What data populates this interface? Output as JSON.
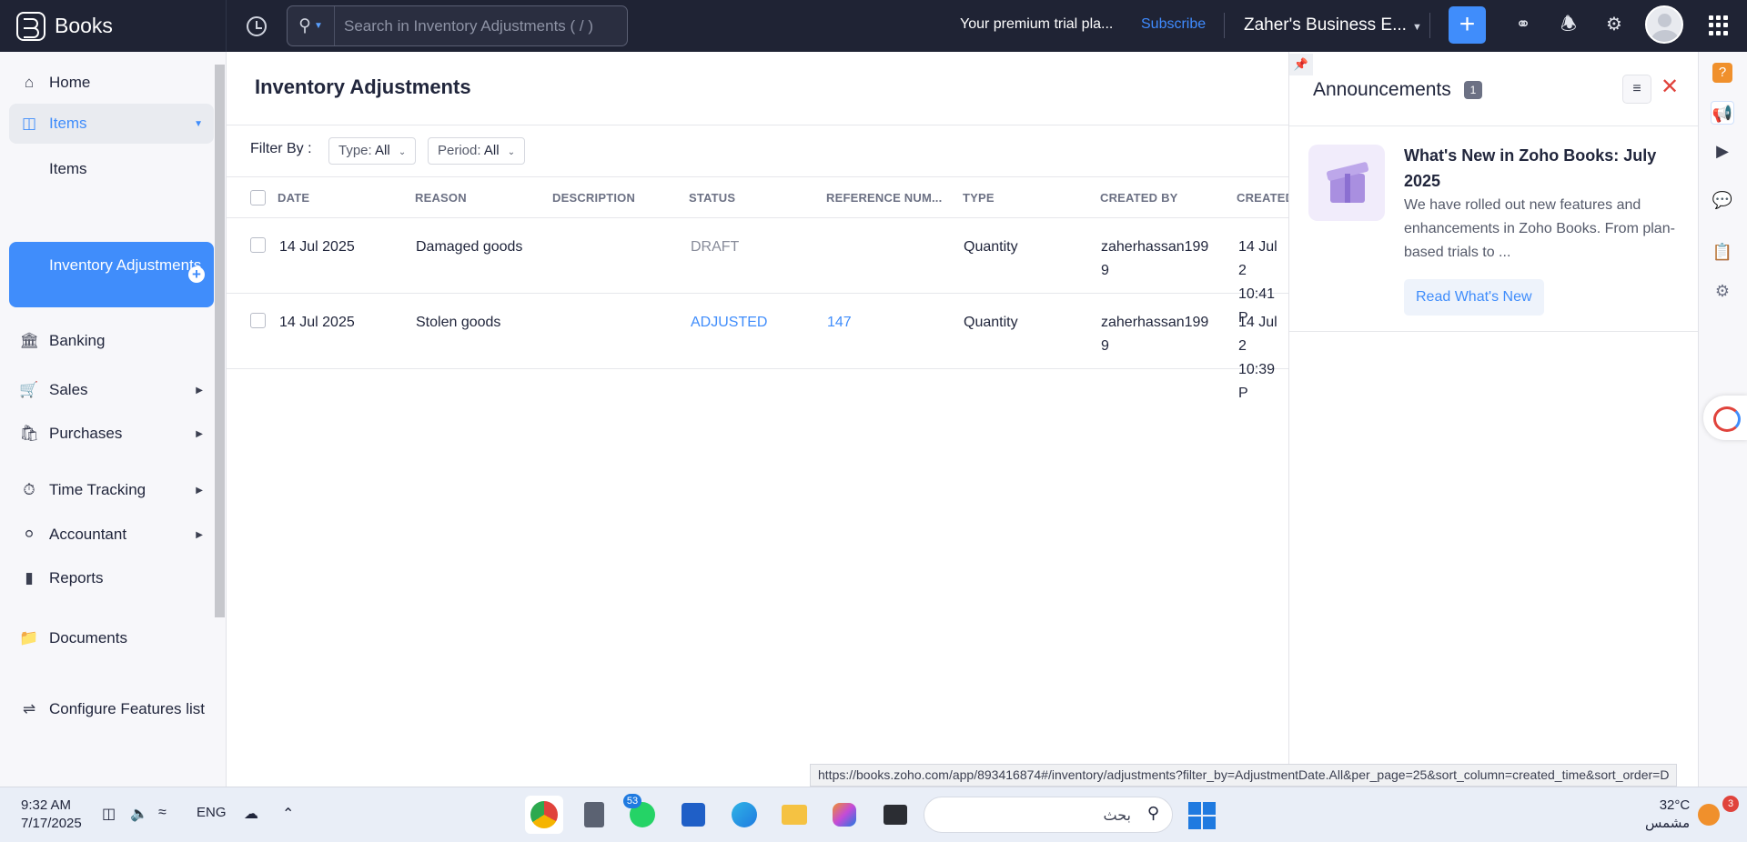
{
  "app": {
    "brand": "Books",
    "search_placeholder": "Search in Inventory Adjustments ( / )",
    "trial_text": "Your premium trial pla...",
    "subscribe": "Subscribe",
    "org_name": "Zaher's Business E..."
  },
  "sidebar": {
    "home": "Home",
    "items_parent": "Items",
    "items_sub": "Items",
    "inventory_adjustments": "Inventory Adjustments",
    "banking": "Banking",
    "sales": "Sales",
    "purchases": "Purchases",
    "time_tracking": "Time Tracking",
    "accountant": "Accountant",
    "reports": "Reports",
    "documents": "Documents",
    "configure": "Configure Features list"
  },
  "main": {
    "title": "Inventory Adjustments",
    "filter_by": "Filter By :",
    "type_label": "Type:",
    "type_value": "All",
    "period_label": "Period:",
    "period_value": "All",
    "columns": [
      "DATE",
      "REASON",
      "DESCRIPTION",
      "STATUS",
      "REFERENCE NUM...",
      "TYPE",
      "CREATED BY",
      "CREATED"
    ],
    "rows": [
      {
        "date": "14 Jul 2025",
        "reason": "Damaged goods",
        "description": "",
        "status": "DRAFT",
        "reference": "",
        "type": "Quantity",
        "created_by_1": "zaherhassan199",
        "created_by_2": "9",
        "created_1": "14 Jul 2",
        "created_2": "10:41 P"
      },
      {
        "date": "14 Jul 2025",
        "reason": "Stolen goods",
        "description": "",
        "status": "ADJUSTED",
        "reference": "147",
        "type": "Quantity",
        "created_by_1": "zaherhassan199",
        "created_by_2": "9",
        "created_1": "14 Jul 2",
        "created_2": "10:39 P"
      }
    ]
  },
  "announcements": {
    "title": "Announcements",
    "count": "1",
    "headline": "What's New in Zoho Books: July 2025",
    "body": "We have rolled out new features and enhancements in Zoho Books. From plan-based trials to ...",
    "cta": "Read What's New"
  },
  "status_url": "https://books.zoho.com/app/893416874#/inventory/adjustments?filter_by=AdjustmentDate.All&per_page=25&sort_column=created_time&sort_order=D",
  "taskbar": {
    "time": "9:32 AM",
    "date": "7/17/2025",
    "lang": "ENG",
    "search_text": "بحث",
    "whatsapp_badge": "53",
    "temperature": "32°C",
    "weather": "مشمس",
    "notif_count": "3"
  },
  "colors": {
    "accent": "#408dfb",
    "topbar": "#1f2334",
    "danger": "#e0433c"
  }
}
